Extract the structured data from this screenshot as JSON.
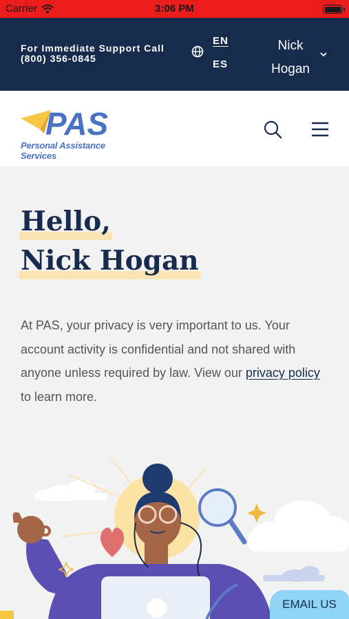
{
  "status_bar": {
    "carrier": "Carrier",
    "time": "3:06 PM"
  },
  "support": {
    "line1": "For Immediate Support Call",
    "line2": "(800) 356-0845",
    "lang_en": "EN",
    "lang_es": "ES",
    "user_first": "Nick",
    "user_last": "Hogan"
  },
  "header": {
    "logo_text": "PAS",
    "logo_subtitle": "Personal Assistance Services"
  },
  "main": {
    "greeting_line1": "Hello,",
    "greeting_line2": "Nick Hogan",
    "privacy_before": "At PAS, your privacy is very important to us. Your account activity is confidential and not shared with anyone unless required by law. View our ",
    "privacy_link": "privacy policy",
    "privacy_after": " to learn more."
  },
  "email_button": {
    "label": "EMAIL US"
  },
  "colors": {
    "navy": "#172b4d",
    "status_red": "#ea1c1c",
    "highlight": "#fbe4b4",
    "email_blue": "#8fd4f4",
    "logo_blue": "#4a72c4",
    "logo_yellow": "#f6c744"
  }
}
